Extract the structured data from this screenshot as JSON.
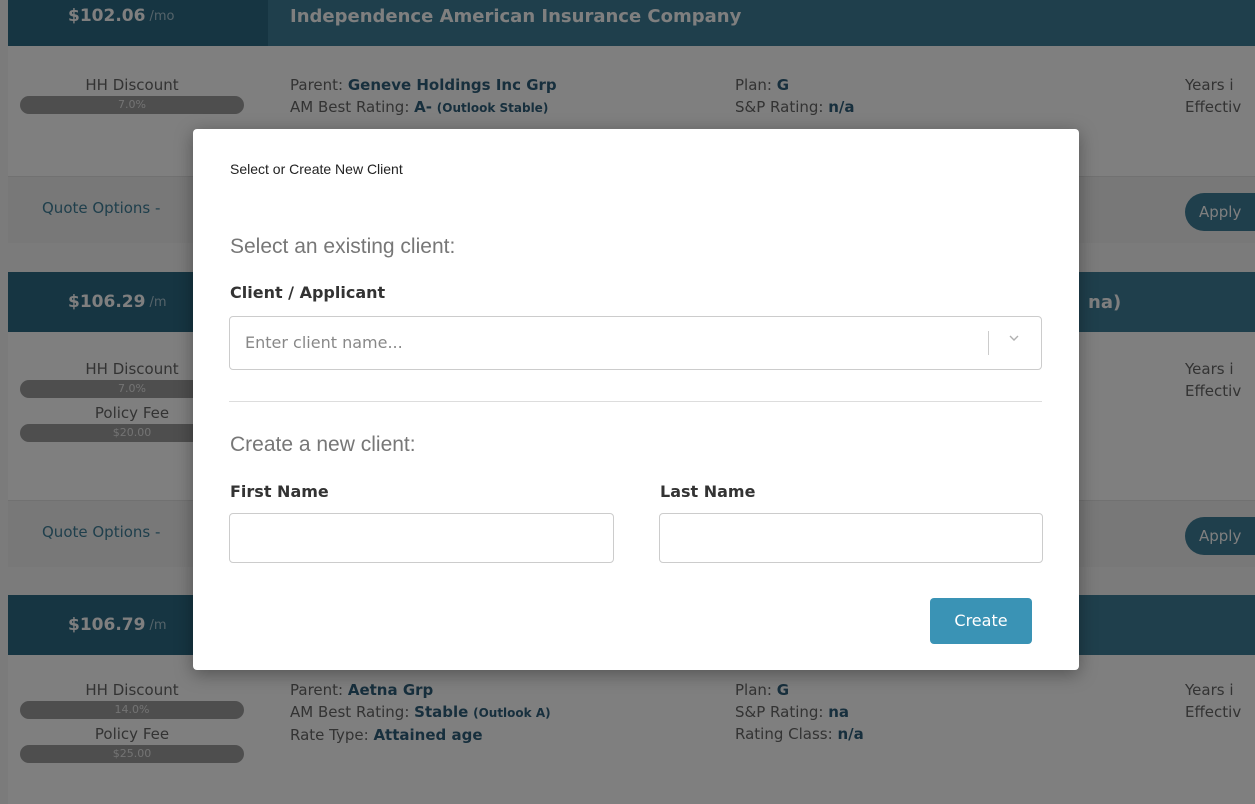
{
  "background": {
    "cards": [
      {
        "price": "$102.06",
        "per": "/mo",
        "company": "Independence American Insurance Company",
        "hh_discount_label": "HH Discount",
        "hh_discount_value": "7.0%",
        "parent_label": "Parent:",
        "parent_value": "Geneve Holdings Inc Grp",
        "am_best_label": "AM Best Rating:",
        "am_best_value": "A-",
        "am_best_outlook": "(Outlook Stable)",
        "plan_label": "Plan:",
        "plan_value": "G",
        "sp_label": "S&P Rating:",
        "sp_value": "n/a",
        "years_label": "Years i",
        "effective_label": "Effectiv",
        "quote_options": "Quote Options -",
        "apply": "Apply"
      },
      {
        "price": "$106.29",
        "per": "/m",
        "company_suffix": "na)",
        "hh_discount_label": "HH Discount",
        "hh_discount_value": "7.0%",
        "policy_fee_label": "Policy Fee",
        "policy_fee_value": "$20.00",
        "years_label": "Years i",
        "effective_label": "Effectiv",
        "quote_options": "Quote Options -",
        "apply": "Apply"
      },
      {
        "price": "$106.79",
        "per": "/m",
        "hh_discount_label": "HH Discount",
        "hh_discount_value": "14.0%",
        "policy_fee_label": "Policy Fee",
        "policy_fee_value": "$25.00",
        "parent_label": "Parent:",
        "parent_value": "Aetna Grp",
        "am_best_label": "AM Best Rating:",
        "am_best_value": "Stable",
        "am_best_outlook": "(Outlook A)",
        "rate_type_label": "Rate Type:",
        "rate_type_value": "Attained age",
        "plan_label": "Plan:",
        "plan_value": "G",
        "sp_label": "S&P Rating:",
        "sp_value": "na",
        "rating_class_label": "Rating Class:",
        "rating_class_value": "n/a",
        "years_label": "Years i",
        "effective_label": "Effectiv"
      }
    ]
  },
  "modal": {
    "title": "Select or Create New Client",
    "existing_heading": "Select an existing client:",
    "client_label": "Client / Applicant",
    "client_placeholder": "Enter client name...",
    "new_heading": "Create a new client:",
    "first_name_label": "First Name",
    "first_name_value": "",
    "last_name_label": "Last Name",
    "last_name_value": "",
    "create_button": "Create"
  },
  "colors": {
    "header_bar": "#3f7e98",
    "price_box": "#2d6a85",
    "overlay": "rgba(0,0,0,0.5)",
    "create_button": "#3a93b5"
  }
}
